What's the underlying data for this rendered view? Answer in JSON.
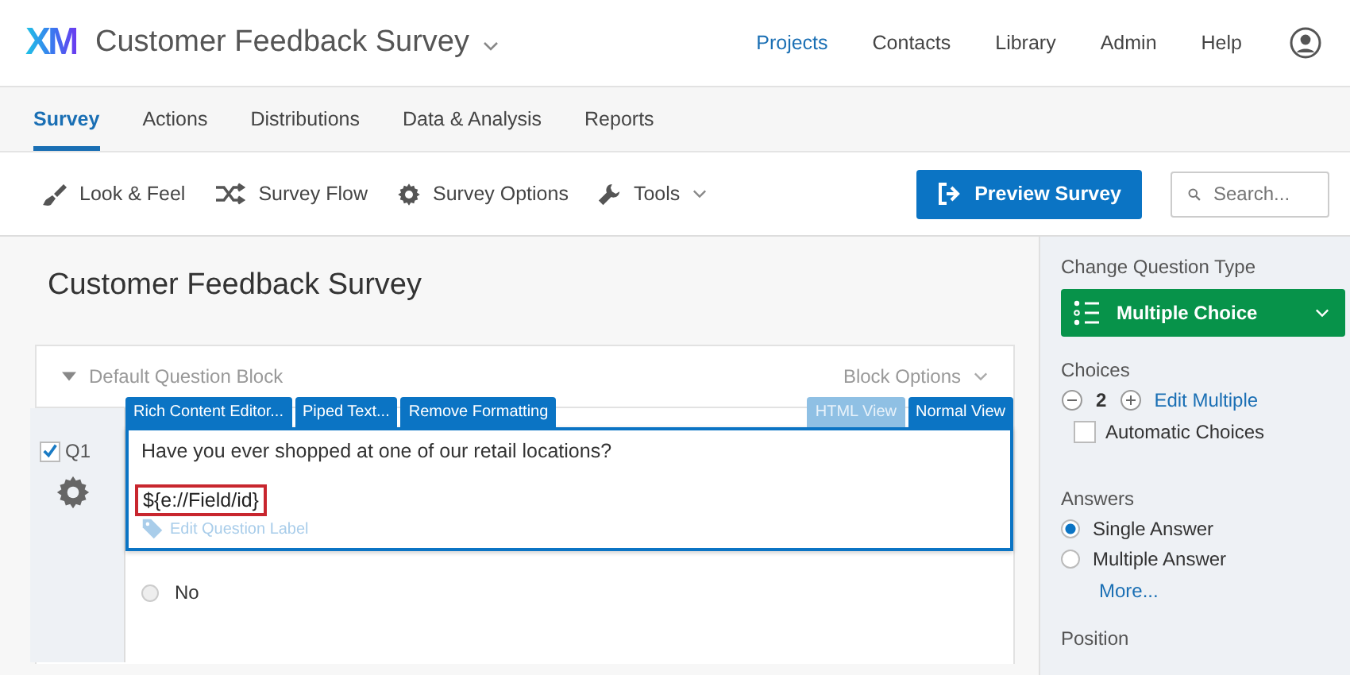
{
  "app": {
    "logo": "XM",
    "title": "Customer Feedback Survey"
  },
  "nav": [
    {
      "label": "Projects",
      "selected": true
    },
    {
      "label": "Contacts",
      "selected": false
    },
    {
      "label": "Library",
      "selected": false
    },
    {
      "label": "Admin",
      "selected": false
    },
    {
      "label": "Help",
      "selected": false
    }
  ],
  "tabs": [
    {
      "label": "Survey",
      "selected": true
    },
    {
      "label": "Actions",
      "selected": false
    },
    {
      "label": "Distributions",
      "selected": false
    },
    {
      "label": "Data & Analysis",
      "selected": false
    },
    {
      "label": "Reports",
      "selected": false
    }
  ],
  "toolbar": [
    {
      "label": "Look & Feel",
      "kind": "brush",
      "dropdown": false
    },
    {
      "label": "Survey Flow",
      "kind": "flow",
      "dropdown": false
    },
    {
      "label": "Survey Options",
      "kind": "gear",
      "dropdown": false
    },
    {
      "label": "Tools",
      "kind": "wrench",
      "dropdown": true
    }
  ],
  "preview_button": "Preview Survey",
  "search": {
    "placeholder": "Search..."
  },
  "survey_title": "Customer Feedback Survey",
  "block": {
    "name": "Default Question Block",
    "options": "Block Options"
  },
  "question": {
    "number": "Q1",
    "checked": true,
    "editor_tools": [
      "Rich Content Editor...",
      "Piped Text...",
      "Remove Formatting"
    ],
    "views": [
      {
        "label": "HTML View",
        "selected": false
      },
      {
        "label": "Normal View",
        "selected": true
      }
    ],
    "text": "Have you ever shopped at one of our retail locations?",
    "piped_field": "${e://Field/id}",
    "label_link": "Edit Question Label",
    "choices": [
      {
        "label": "No",
        "selected": false
      }
    ]
  },
  "sidebar": {
    "type_heading": "Change Question Type",
    "question_type": "Multiple Choice",
    "choices_heading": "Choices",
    "choice_count": "2",
    "edit_multiple": "Edit Multiple",
    "automatic_choices": {
      "label": "Automatic Choices",
      "checked": false
    },
    "answers_heading": "Answers",
    "answers": [
      {
        "label": "Single Answer",
        "selected": true
      },
      {
        "label": "Multiple Answer",
        "selected": false
      }
    ],
    "more": "More...",
    "position_heading": "Position"
  }
}
